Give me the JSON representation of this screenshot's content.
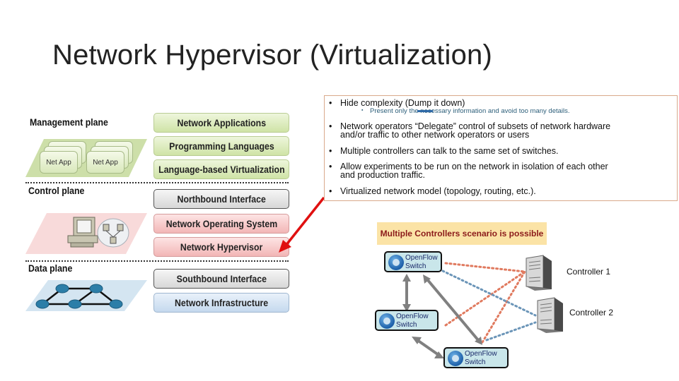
{
  "title": "Network Hypervisor (Virtualization)",
  "diagram": {
    "planes": {
      "management": "Management plane",
      "control": "Control plane",
      "data": "Data plane"
    },
    "net_apps": [
      "Net App",
      "Net App"
    ],
    "layers": [
      {
        "label": "Network Applications",
        "group": "management"
      },
      {
        "label": "Programming Languages",
        "group": "management"
      },
      {
        "label": "Language-based Virtualization",
        "group": "management"
      },
      {
        "label": "Northbound Interface",
        "group": "interface"
      },
      {
        "label": "Network Operating System",
        "group": "control"
      },
      {
        "label": "Network Hypervisor",
        "group": "control"
      },
      {
        "label": "Southbound Interface",
        "group": "interface"
      },
      {
        "label": "Network Infrastructure",
        "group": "data"
      }
    ]
  },
  "bullets": [
    {
      "text": "Hide complexity (Dump it down)",
      "sub": "Present only the necessary information and avoid too many details."
    },
    {
      "text": "Network operators “Delegate” control of subsets of network hardware",
      "text2": "and/or traffic to other network operators or users"
    },
    {
      "text": "Multiple controllers can talk to the same set of switches."
    },
    {
      "text": "Allow experiments to be run on the network in isolation of each other",
      "text2": "and production traffic."
    },
    {
      "text": "Virtualized network model (topology, routing, etc.)."
    }
  ],
  "scenario": {
    "banner": "Multiple Controllers scenario is possible",
    "switch_line1": "OpenFlow",
    "switch_line2": "Switch",
    "controllers": [
      "Controller 1",
      "Controller 2"
    ]
  },
  "colors": {
    "controller1_links": "#e07a5f",
    "controller2_links": "#6b95b8",
    "arrow": "#e01010",
    "banner_bg": "#fbe3a6",
    "banner_text": "#8b1a1a"
  }
}
